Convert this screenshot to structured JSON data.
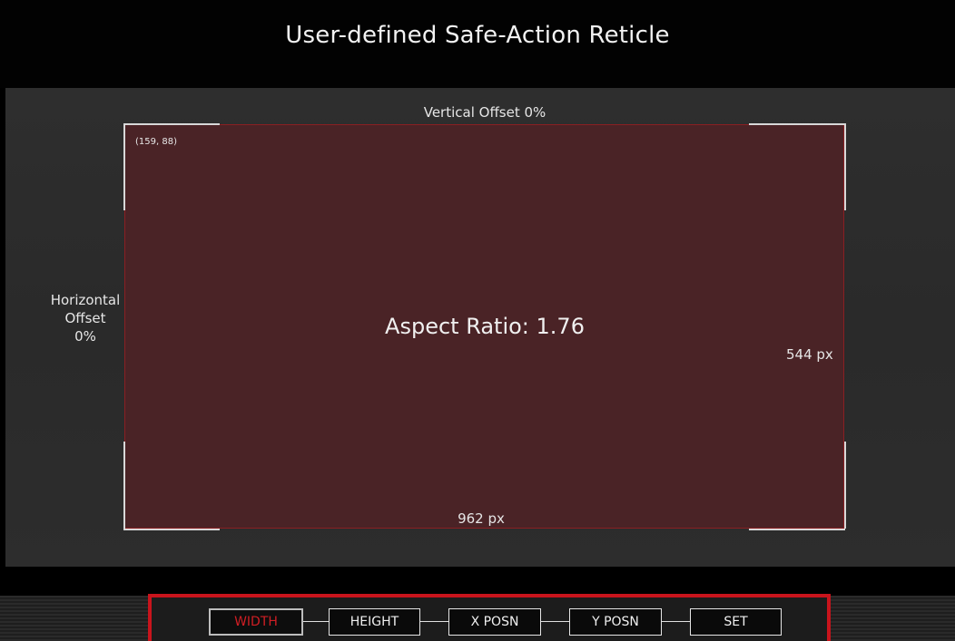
{
  "title": "User-defined Safe-Action Reticle",
  "reticle": {
    "vertical_offset_label": "Vertical Offset 0%",
    "coordinates": "(159, 88)",
    "horizontal_offset_lines": [
      "Horizontal",
      "Offset",
      "0%"
    ],
    "aspect_ratio_label": "Aspect Ratio: 1.76",
    "height_label": "544 px",
    "width_label": "962 px"
  },
  "toolbar": {
    "buttons": [
      {
        "label": "WIDTH",
        "selected": true
      },
      {
        "label": "HEIGHT",
        "selected": false
      },
      {
        "label": "X POSN",
        "selected": false
      },
      {
        "label": "Y POSN",
        "selected": false
      },
      {
        "label": "SET",
        "selected": false
      }
    ]
  },
  "colors": {
    "accent_red": "#c8141c",
    "safe_area_fill": "#4a2326",
    "selected_text": "#d01e24"
  }
}
